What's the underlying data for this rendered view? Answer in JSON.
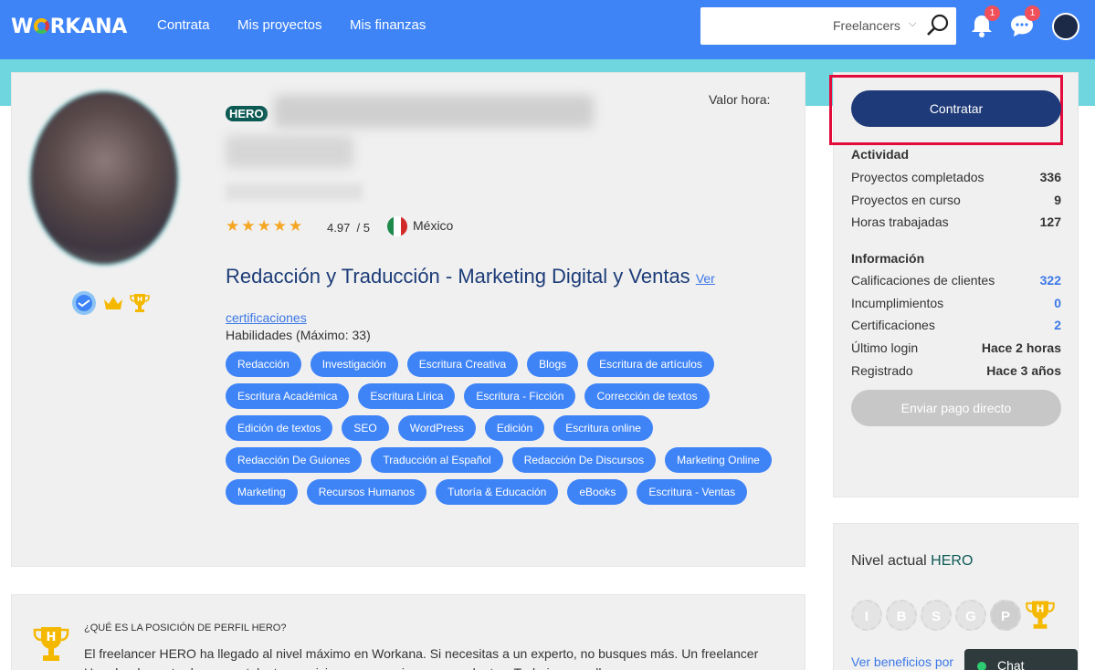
{
  "header": {
    "logo": "WORKANA",
    "nav": [
      "Contrata",
      "Mis proyectos",
      "Mis finanzas"
    ],
    "search": {
      "placeholder": "",
      "category": "Freelancers"
    },
    "notifications_count": "1",
    "messages_count": "1"
  },
  "profile": {
    "hero_badge": "HERO",
    "valor_hora_label": "Valor hora:",
    "rating": "4.97",
    "rating_max": "/ 5",
    "country": "México",
    "headline": "Redacción y Traducción - Marketing Digital y Ventas",
    "certificaciones_link": "Ver certificaciones",
    "skills_label": "Habilidades (Máximo: 33)",
    "skills": [
      "Redacción",
      "Investigación",
      "Escritura Creativa",
      "Blogs",
      "Escritura de artículos",
      "Escritura Académica",
      "Escritura Lírica",
      "Escritura - Ficción",
      "Corrección de textos",
      "Edición de textos",
      "SEO",
      "WordPress",
      "Edición",
      "Escritura online",
      "Redacción De Guiones",
      "Traducción al Español",
      "Redacción De Discursos",
      "Marketing Online",
      "Marketing",
      "Recursos Humanos",
      "Tutoría & Educación",
      "eBooks",
      "Escritura - Ventas"
    ]
  },
  "sidebar": {
    "contratar": "Contratar",
    "actividad_title": "Actividad",
    "actividad": [
      {
        "label": "Proyectos completados",
        "value": "336"
      },
      {
        "label": "Proyectos en curso",
        "value": "9"
      },
      {
        "label": "Horas trabajadas",
        "value": "127"
      }
    ],
    "informacion_title": "Información",
    "informacion": [
      {
        "label": "Calificaciones de clientes",
        "value": "322"
      },
      {
        "label": "Incumplimientos",
        "value": "0"
      },
      {
        "label": "Certificaciones",
        "value": "2"
      },
      {
        "label": "Último login",
        "value": "Hace 2 horas"
      },
      {
        "label": "Registrado",
        "value": "Hace 3 años"
      }
    ],
    "enviar_pago": "Enviar pago directo",
    "nivel_label": "Nivel actual",
    "nivel_value": "HERO",
    "levels": [
      "I",
      "B",
      "S",
      "G",
      "P",
      "H"
    ],
    "ver_beneficios": "Ver beneficios por"
  },
  "hero_info": {
    "question": "¿QUÉ ES LA POSICIÓN DE PERFIL HERO?",
    "text": "El freelancer HERO ha llegado al nivel máximo en Workana. Si necesitas a un experto, no busques más. Un freelancer Hero ha demostrado que su talento, servicio y compromiso son excelentes. Trabajar con ellos es un"
  },
  "chat": {
    "label": "Chat"
  },
  "colors": {
    "primary": "#3f84f7",
    "dark_blue": "#1e3a78",
    "hero": "#0d5a55",
    "highlight": "#e30b3c"
  }
}
